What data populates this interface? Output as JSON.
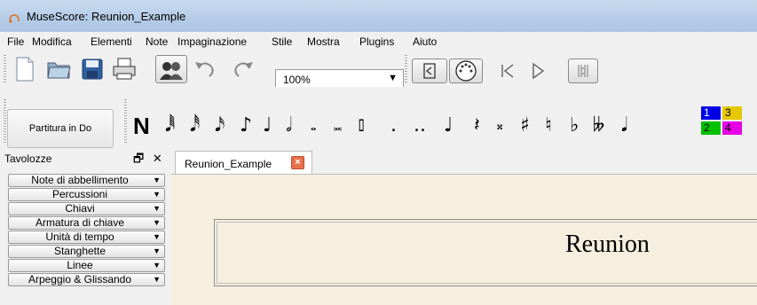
{
  "window": {
    "title": "MuseScore: Reunion_Example"
  },
  "menubar": [
    "File",
    "Modifica",
    "Elementi",
    "Note",
    "Impaginazione",
    "Stile",
    "Mostra",
    "Plugins",
    "Aiuto"
  ],
  "toolbar": {
    "zoom_value": "100%",
    "icons": [
      "new-file-icon",
      "open-file-icon",
      "save-icon",
      "print-icon",
      "mixer-icon",
      "undo-icon",
      "redo-icon",
      "speaker-icon",
      "midi-input-icon",
      "rewind-icon",
      "play-icon",
      "loop-icon"
    ]
  },
  "note_toolbar": {
    "concert_pitch_label": "Partitura in Do",
    "note_entry_label": "N",
    "dot_single": ".",
    "dot_double": "..",
    "voices": [
      "1",
      "2",
      "3",
      "4"
    ],
    "voice_colors": [
      "#0000e6",
      "#00c000",
      "#e6c800",
      "#e600e6"
    ]
  },
  "palette": {
    "title": "Tavolozze",
    "items": [
      "Note di abbellimento",
      "Percussioni",
      "Chiavi",
      "Armatura di chiave",
      "Unità di tempo",
      "Stanghette",
      "Linee",
      "Arpeggio & Glissando"
    ]
  },
  "tabs": [
    {
      "label": "Reunion_Example"
    }
  ],
  "score": {
    "title": "Reunion"
  }
}
